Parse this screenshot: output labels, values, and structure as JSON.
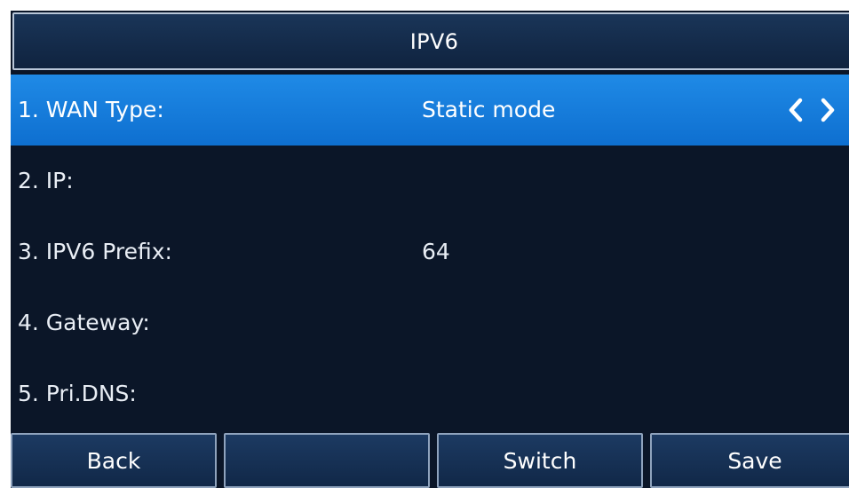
{
  "header": {
    "title": "IPV6"
  },
  "rows": [
    {
      "label": "1. WAN Type:",
      "value": "Static mode",
      "selected": true,
      "has_arrows": true
    },
    {
      "label": "2. IP:",
      "value": ""
    },
    {
      "label": "3. IPV6 Prefix:",
      "value": "64"
    },
    {
      "label": "4. Gateway:",
      "value": ""
    },
    {
      "label": "5. Pri.DNS:",
      "value": ""
    }
  ],
  "softkeys": [
    "Back",
    "",
    "Switch",
    "Save"
  ],
  "icons": {
    "left": "chevron-left-icon",
    "right": "chevron-right-icon"
  },
  "colors": {
    "background": "#0b1628",
    "selected_row": "#1f8ae6",
    "softkey_bg": "#1c3a62",
    "border": "#b8c6d8",
    "text": "#ffffff"
  }
}
